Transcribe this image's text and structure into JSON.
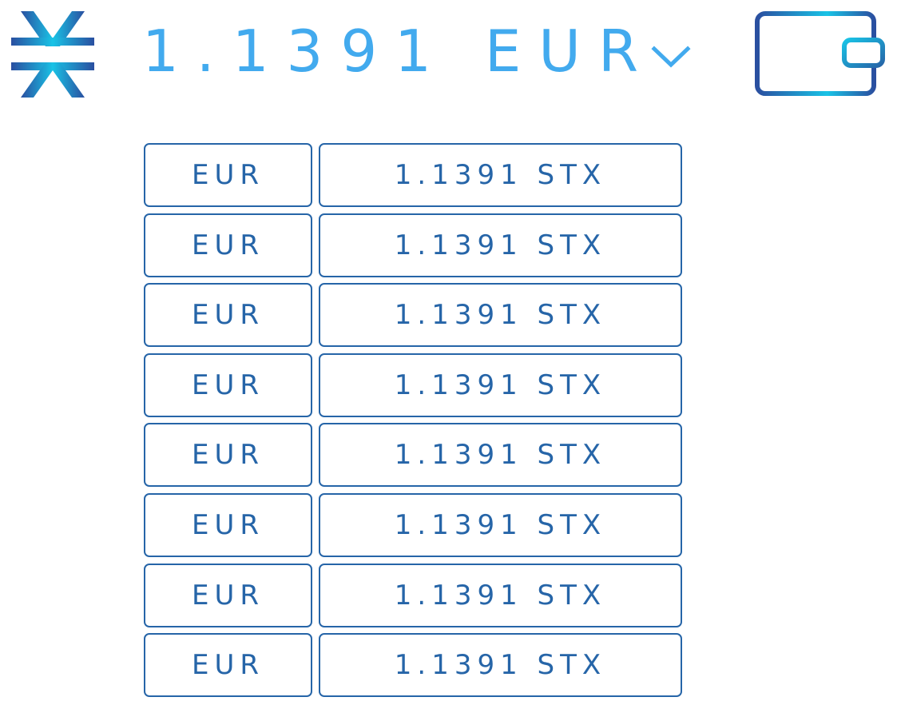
{
  "header": {
    "price": "1.1391 EUR",
    "logo_icon": "stacks-logo-icon",
    "dropdown_icon": "chevron-down-icon",
    "wallet_icon": "wallet-icon"
  },
  "colors": {
    "header_text": "#42aaee",
    "table_text": "#2665a8",
    "table_border": "#2665a8",
    "gradient_dark": "#2a4fa0",
    "gradient_light": "#19c3e6"
  },
  "rates": [
    {
      "currency": "EUR",
      "amount": "1.1391 STX"
    },
    {
      "currency": "EUR",
      "amount": "1.1391 STX"
    },
    {
      "currency": "EUR",
      "amount": "1.1391 STX"
    },
    {
      "currency": "EUR",
      "amount": "1.1391 STX"
    },
    {
      "currency": "EUR",
      "amount": "1.1391 STX"
    },
    {
      "currency": "EUR",
      "amount": "1.1391 STX"
    },
    {
      "currency": "EUR",
      "amount": "1.1391 STX"
    },
    {
      "currency": "EUR",
      "amount": "1.1391 STX"
    }
  ]
}
